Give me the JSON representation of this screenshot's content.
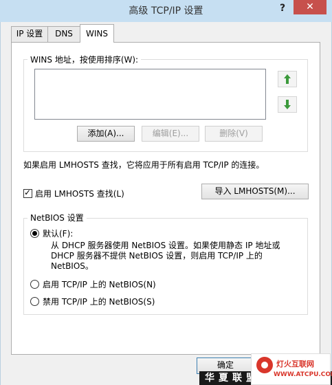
{
  "window": {
    "title": "高级 TCP/IP 设置",
    "help_label": "?",
    "close_label": "✕"
  },
  "tabs": [
    {
      "label": "IP 设置"
    },
    {
      "label": "DNS"
    },
    {
      "label": "WINS"
    }
  ],
  "wins": {
    "group_label": "WINS 地址，按使用排序(W):",
    "add_label": "添加(A)...",
    "edit_label": "编辑(E)...",
    "remove_label": "删除(V)"
  },
  "lmhosts": {
    "description": "如果启用 LMHOSTS 查找，它将应用于所有启用 TCP/IP 的连接。",
    "checkbox_label": "启用 LMHOSTS 查找(L)",
    "checked": true,
    "import_label": "导入 LMHOSTS(M)..."
  },
  "netbios": {
    "group_label": "NetBIOS 设置",
    "options": [
      {
        "label": "默认(F):",
        "selected": true
      },
      {
        "label": "启用 TCP/IP 上的 NetBIOS(N)",
        "selected": false
      },
      {
        "label": "禁用 TCP/IP 上的 NetBIOS(S)",
        "selected": false
      }
    ],
    "default_description": "从 DHCP 服务器使用 NetBIOS 设置。如果使用静态 IP 地址或 DHCP 服务器不提供 NetBIOS 设置，则启用 TCP/IP 上的 NetBIOS。"
  },
  "footer": {
    "ok_label": "确定",
    "watermark_strip": "华夏联盟",
    "watermark_name": "灯火互联网",
    "watermark_url": "WWW.ATCPU.COM"
  },
  "colors": {
    "titlebar": "#c6dff2",
    "close": "#c7504c",
    "arrow_icon": "#3c9a3c",
    "watermark": "#d9362b"
  }
}
